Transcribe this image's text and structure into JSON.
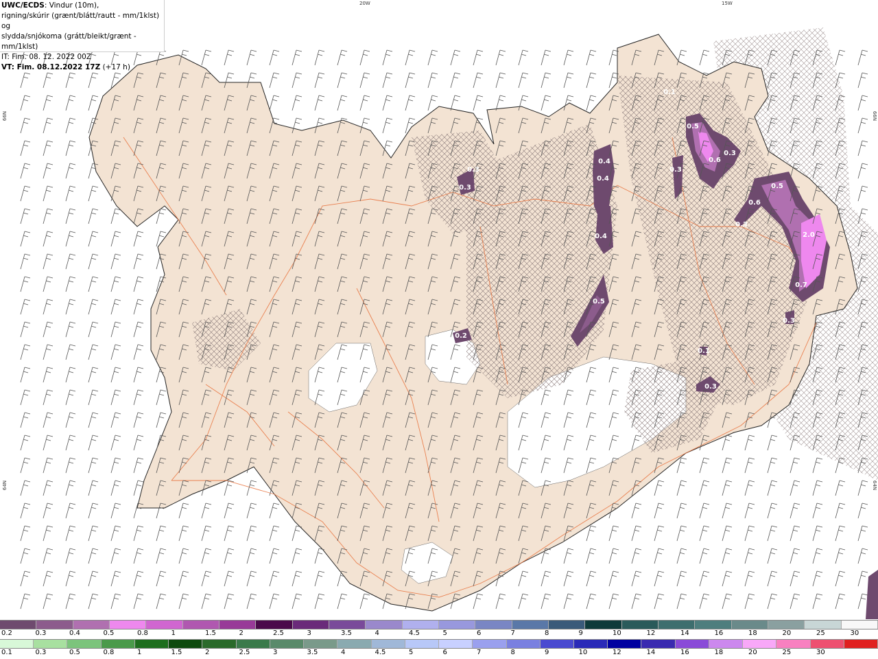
{
  "info": {
    "model": "UWC/ECDS",
    "line1": ": Vindur (10m),",
    "line2": "rigning/skúrir (grænt/blátt/rautt - mm/1klst) og",
    "line3": "slydda/snjókoma (grátt/bleikt/grænt - mm/1klst)",
    "it": "IT: Fim. 08. 12. 2022 00Z",
    "vt_label": "VT: Fim. 08.12.2022 17Z",
    "vt_offset": " (+17 h)"
  },
  "axes": {
    "top_left": "20W",
    "top_right": "15W",
    "left_top": "66N",
    "left_bottom": "64N",
    "right_top": "66N",
    "right_bottom": "64N"
  },
  "precip_labels": [
    "0.4",
    "0.4",
    "0.4",
    "0.5",
    "0.3",
    "0.5",
    "0.6",
    "0.3",
    "0.3",
    "0.5",
    "0.6",
    "0.3",
    "2.0",
    "0.7",
    "0.3",
    "0.2",
    "0.3",
    "0.1",
    "0.1",
    "0.3"
  ],
  "snow_scale": {
    "colors": [
      "#6e4a6e",
      "#8c5c8c",
      "#b070b0",
      "#ee88ee",
      "#d066d0",
      "#b058b0",
      "#983a98",
      "#4a0a4a",
      "#6a2a7a",
      "#7a4a9a",
      "#9a88cc",
      "#b0b0ee",
      "#9898dd",
      "#7a86c4",
      "#5a78a8",
      "#3a5a7a",
      "#0e3a3a",
      "#2a5a5a",
      "#3e6e6e",
      "#4e7e7e",
      "#6a8a8a",
      "#8aa0a0",
      "#c8d6d6",
      "#f8f8f8"
    ],
    "labels": [
      "0.2",
      "0.3",
      "0.4",
      "0.5",
      "0.8",
      "1",
      "1.5",
      "2",
      "2.5",
      "3",
      "3.5",
      "4",
      "4.5",
      "5",
      "6",
      "7",
      "8",
      "9",
      "10",
      "12",
      "14",
      "16",
      "18",
      "20",
      "25",
      "30"
    ]
  },
  "rain_scale": {
    "colors": [
      "#d8f8d8",
      "#a8e0a0",
      "#7cc47c",
      "#4a9a4a",
      "#1e6e1e",
      "#0e4a0e",
      "#2a6a2a",
      "#3a7a4a",
      "#5a8a6a",
      "#7a9a8a",
      "#8aaab0",
      "#a0b8d8",
      "#b8c8f8",
      "#c8d0ff",
      "#9aa0ee",
      "#7a80e0",
      "#4a4ad0",
      "#2a2ab8",
      "#0000a0",
      "#3a2ab0",
      "#8a4ad8",
      "#cc88ee",
      "#f8a8f8",
      "#f880c0",
      "#ee5070",
      "#e02020"
    ],
    "labels": [
      "0.1",
      "0.3",
      "0.5",
      "0.8",
      "1",
      "1.5",
      "2",
      "2.5",
      "3",
      "3.5",
      "4",
      "4.5",
      "5",
      "6",
      "7",
      "8",
      "9",
      "10",
      "12",
      "14",
      "16",
      "18",
      "20",
      "25",
      "30"
    ]
  }
}
